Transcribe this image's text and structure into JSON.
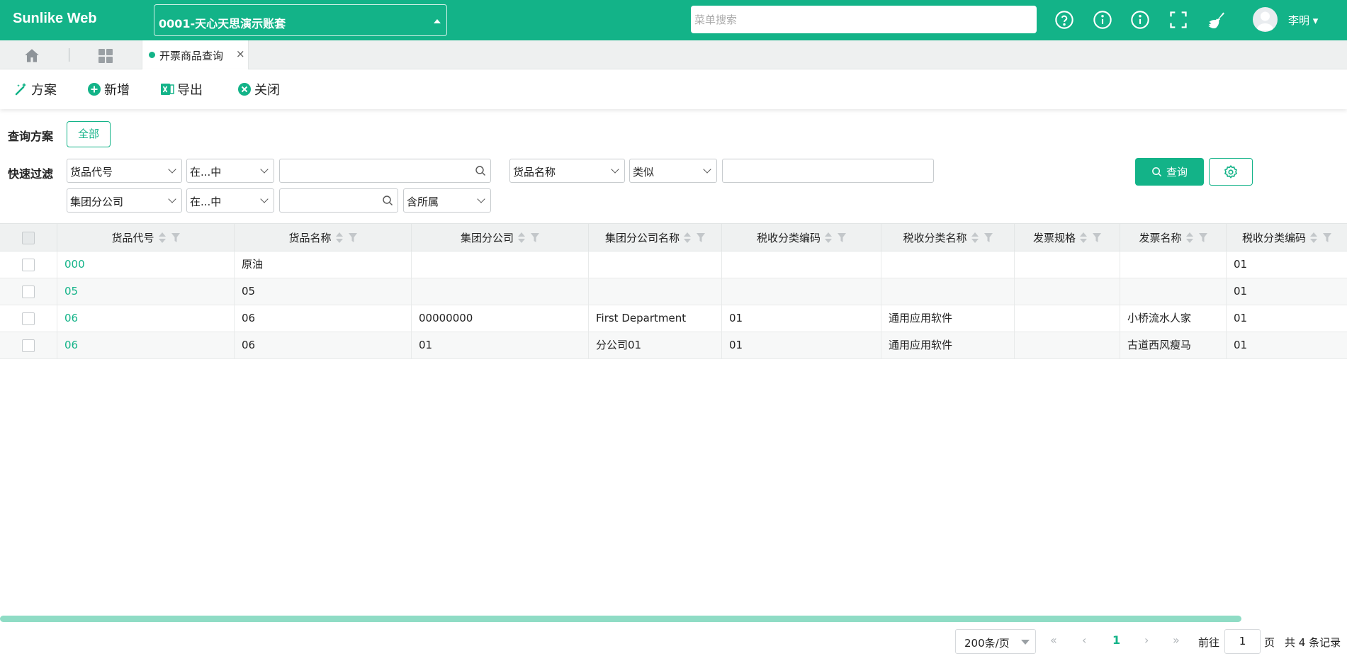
{
  "header": {
    "logo": "Sunlike Web",
    "account": "0001-天心天思演示账套",
    "search_placeholder": "菜单搜索",
    "user_name": "李明 ▾",
    "icons": [
      "help-circle-icon",
      "info-icon",
      "info-icon",
      "fullscreen-icon",
      "broom-icon"
    ]
  },
  "tabs": {
    "active_label": "开票商品查询",
    "close_glyph": "×"
  },
  "toolbar": {
    "scheme": "方案",
    "add": "新增",
    "export": "导出",
    "close": "关闭"
  },
  "filter": {
    "scheme_label": "查询方案",
    "scheme_chip": "全部",
    "quick_label": "快速过滤",
    "row1": {
      "field1": "货品代号",
      "op1": "在...中",
      "value1": "",
      "field2": "货品名称",
      "op2": "类似",
      "value2": ""
    },
    "row2": {
      "field1": "集团分公司",
      "op1": "在...中",
      "value1": "",
      "scope": "含所属"
    },
    "query_button": "查询"
  },
  "table": {
    "columns": [
      "货品代号",
      "货品名称",
      "集团分公司",
      "集团分公司名称",
      "税收分类编码",
      "税收分类名称",
      "发票规格",
      "发票名称",
      "税收分类编码"
    ],
    "rows": [
      [
        "000",
        "原油",
        "",
        "",
        "",
        "",
        "",
        "",
        "01"
      ],
      [
        "05",
        "05",
        "",
        "",
        "",
        "",
        "",
        "",
        "01"
      ],
      [
        "06",
        "06",
        "00000000",
        "First Department",
        "01",
        "通用应用软件",
        "",
        "小桥流水人家",
        "01"
      ],
      [
        "06",
        "06",
        "01",
        "分公司01",
        "01",
        "通用应用软件",
        "",
        "古道西风瘦马",
        "01"
      ]
    ]
  },
  "pagination": {
    "page_size": "200条/页",
    "current_page": "1",
    "goto_label": "前往",
    "goto_value": "1",
    "page_unit": "页",
    "total": "共 4 条记录",
    "first": "«",
    "prev": "‹",
    "next": "›",
    "last": "»"
  },
  "colors": {
    "brand": "#13b388"
  }
}
